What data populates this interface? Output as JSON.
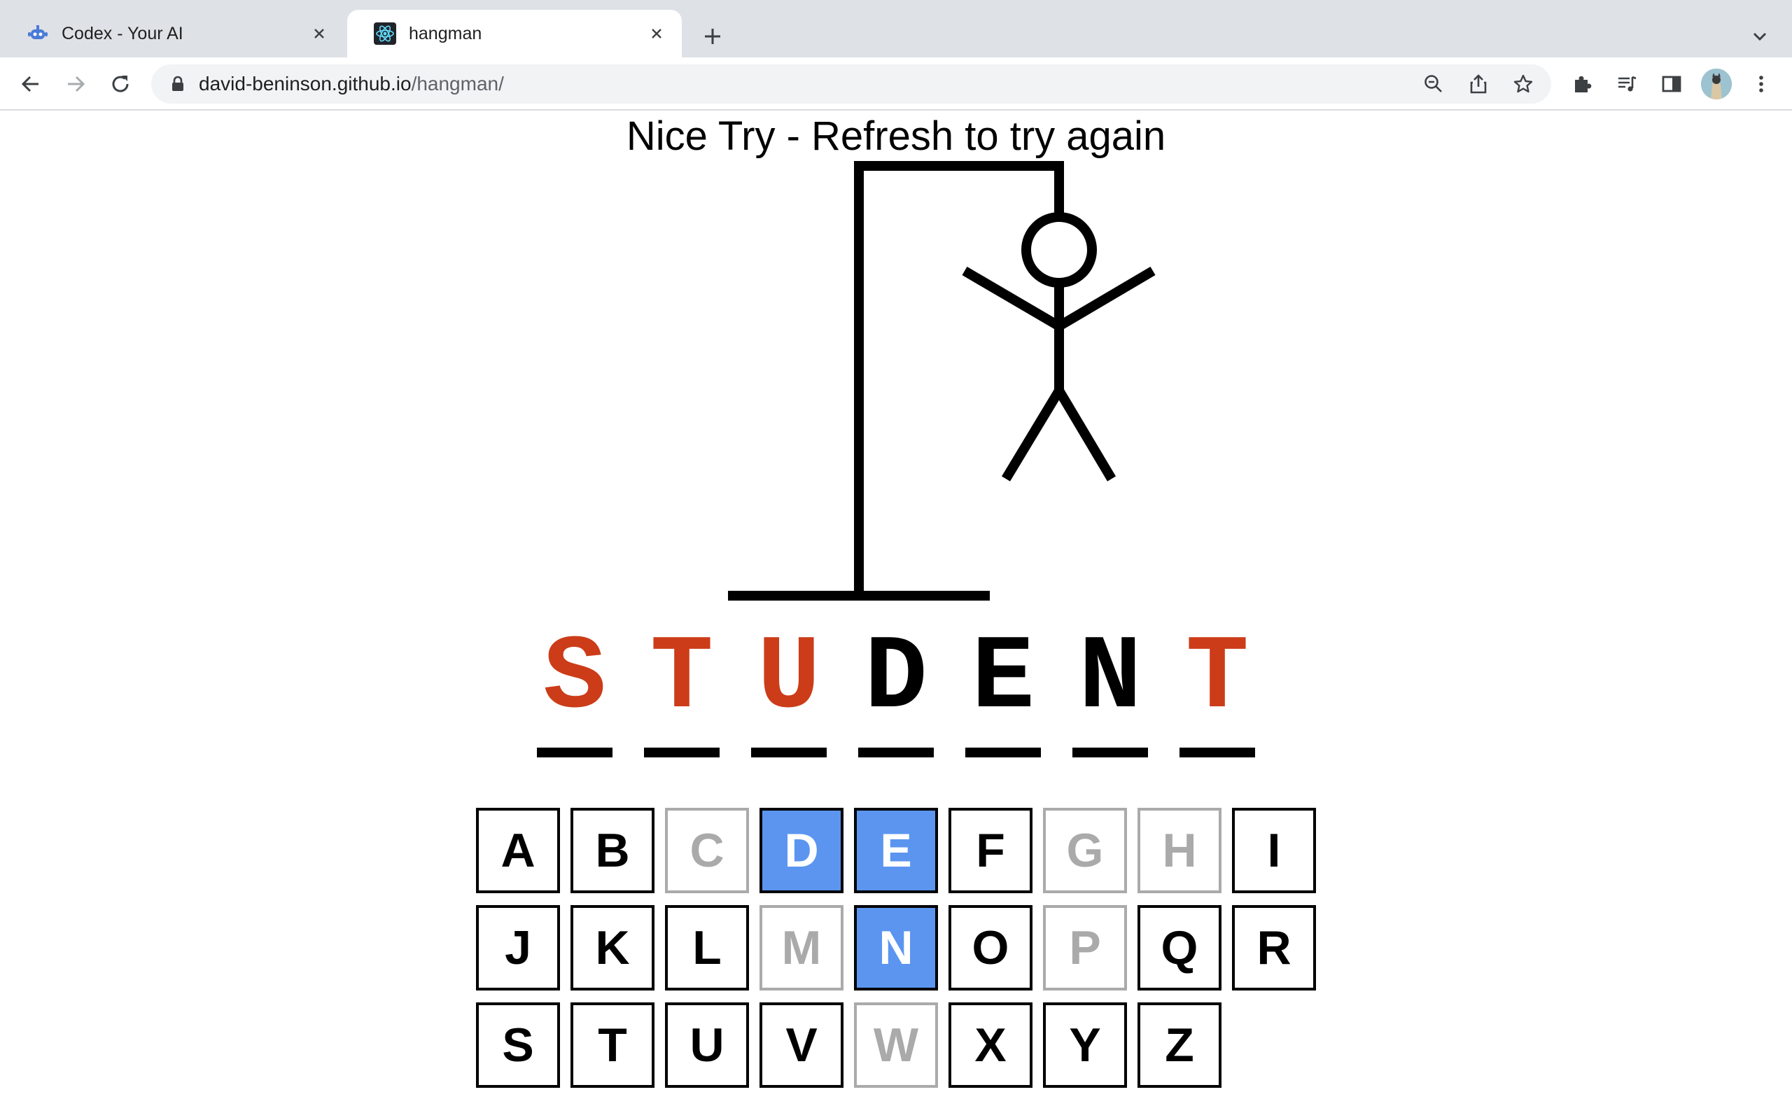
{
  "browser": {
    "tabs": [
      {
        "title": "Codex - Your AI",
        "favicon": "robot-icon",
        "active": false
      },
      {
        "title": "hangman",
        "favicon": "react-icon",
        "active": true
      }
    ],
    "url_host": "david-beninson.github.io",
    "url_path": "/hangman/"
  },
  "game": {
    "message": "Nice Try - Refresh to try again",
    "word": [
      {
        "letter": "S",
        "state": "missed"
      },
      {
        "letter": "T",
        "state": "missed"
      },
      {
        "letter": "U",
        "state": "missed"
      },
      {
        "letter": "D",
        "state": "found"
      },
      {
        "letter": "E",
        "state": "found"
      },
      {
        "letter": "N",
        "state": "found"
      },
      {
        "letter": "T",
        "state": "missed"
      }
    ],
    "keyboard": [
      {
        "letter": "A",
        "state": "unused"
      },
      {
        "letter": "B",
        "state": "unused"
      },
      {
        "letter": "C",
        "state": "wrong"
      },
      {
        "letter": "D",
        "state": "right"
      },
      {
        "letter": "E",
        "state": "right"
      },
      {
        "letter": "F",
        "state": "unused"
      },
      {
        "letter": "G",
        "state": "wrong"
      },
      {
        "letter": "H",
        "state": "wrong"
      },
      {
        "letter": "I",
        "state": "unused"
      },
      {
        "letter": "J",
        "state": "unused"
      },
      {
        "letter": "K",
        "state": "unused"
      },
      {
        "letter": "L",
        "state": "unused"
      },
      {
        "letter": "M",
        "state": "wrong"
      },
      {
        "letter": "N",
        "state": "right"
      },
      {
        "letter": "O",
        "state": "unused"
      },
      {
        "letter": "P",
        "state": "wrong"
      },
      {
        "letter": "Q",
        "state": "unused"
      },
      {
        "letter": "R",
        "state": "unused"
      },
      {
        "letter": "S",
        "state": "unused"
      },
      {
        "letter": "T",
        "state": "unused"
      },
      {
        "letter": "U",
        "state": "unused"
      },
      {
        "letter": "V",
        "state": "unused"
      },
      {
        "letter": "W",
        "state": "wrong"
      },
      {
        "letter": "X",
        "state": "unused"
      },
      {
        "letter": "Y",
        "state": "unused"
      },
      {
        "letter": "Z",
        "state": "unused"
      }
    ]
  },
  "colors": {
    "missed_letter": "#cc3c19",
    "correct_key_bg": "#5b95f0",
    "wrong_key": "#aaaaaa"
  }
}
